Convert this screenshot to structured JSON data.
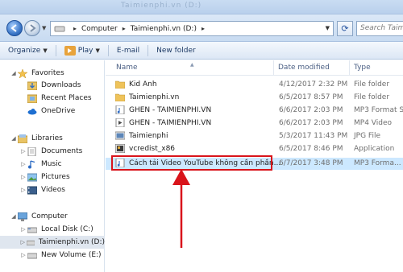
{
  "window": {
    "ghost_title": "Taimienphi.vn (D:)"
  },
  "address": {
    "crumbs": [
      "Computer",
      "Taimienphi.vn (D:)"
    ],
    "search_placeholder": "Search Taimienphi.vn"
  },
  "toolbar": {
    "organize": "Organize",
    "play": "Play",
    "email": "E-mail",
    "new_folder": "New folder"
  },
  "nav": {
    "favorites": "Favorites",
    "downloads": "Downloads",
    "recent_places": "Recent Places",
    "onedrive": "OneDrive",
    "libraries": "Libraries",
    "documents": "Documents",
    "music": "Music",
    "pictures": "Pictures",
    "videos": "Videos",
    "computer": "Computer",
    "local_disk": "Local Disk (C:)",
    "taimienphi": "Taimienphi.vn (D:)",
    "new_volume": "New Volume (E:)"
  },
  "columns": {
    "name": "Name",
    "date": "Date modified",
    "type": "Type"
  },
  "files": [
    {
      "name": "Kid Anh",
      "date": "4/12/2017 2:32 PM",
      "type": "File folder",
      "icon": "folder-icon"
    },
    {
      "name": "Taimienphi.vn",
      "date": "6/5/2017 8:57 PM",
      "type": "File folder",
      "icon": "folder-icon"
    },
    {
      "name": "GHEN - TAIMIENPHI.VN",
      "date": "6/6/2017 2:03 PM",
      "type": "MP3 Format Sound",
      "icon": "audio-file-icon"
    },
    {
      "name": "GHEN - TAIMIENPHI.VN",
      "date": "6/6/2017 2:03 PM",
      "type": "MP4 Video",
      "icon": "video-file-icon"
    },
    {
      "name": "Taimienphi",
      "date": "5/3/2017 11:43 PM",
      "type": "JPG File",
      "icon": "image-file-icon"
    },
    {
      "name": "vcredist_x86",
      "date": "6/5/2017 8:46 PM",
      "type": "Application",
      "icon": "application-icon"
    },
    {
      "name": "Cách tải Video YouTube không cần phần...",
      "date": "6/7/2017 3:48 PM",
      "type": "MP3 Forma...",
      "icon": "audio-file-icon"
    }
  ],
  "colors": {
    "highlight": "#d9141b",
    "selection": "#cce8ff"
  }
}
